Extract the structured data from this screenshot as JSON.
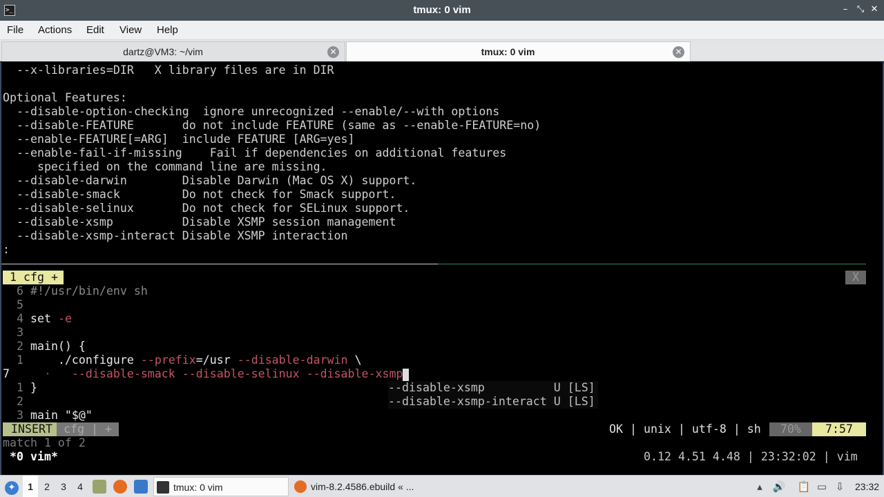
{
  "window": {
    "title": "tmux: 0 vim",
    "minimize_glyph": "–",
    "maximize_glyph": "⤡",
    "close_glyph": "✕"
  },
  "menu": [
    "File",
    "Actions",
    "Edit",
    "View",
    "Help"
  ],
  "tabs": [
    {
      "label": "dartz@VM3: ~/vim",
      "close": "✕"
    },
    {
      "label": "tmux: 0 vim",
      "close": "✕"
    }
  ],
  "help_lines": [
    "  --x-libraries=DIR   X library files are in DIR",
    "",
    "Optional Features:",
    "  --disable-option-checking  ignore unrecognized --enable/--with options",
    "  --disable-FEATURE       do not include FEATURE (same as --enable-FEATURE=no)",
    "  --enable-FEATURE[=ARG]  include FEATURE [ARG=yes]",
    "  --enable-fail-if-missing    Fail if dependencies on additional features",
    "     specified on the command line are missing.",
    "  --disable-darwin        Disable Darwin (Mac OS X) support.",
    "  --disable-smack         Do not check for Smack support.",
    "  --disable-selinux       Do not check for SELinux support.",
    "  --disable-xsmp          Disable XSMP session management",
    "  --disable-xsmp-interact Disable XSMP interaction",
    ":"
  ],
  "vim": {
    "tabline_label": "1 cfg +",
    "tabline_close": "X",
    "lines": {
      "l1_num": "6",
      "l1_text": "#!/usr/bin/env sh",
      "l2_num": "5",
      "l3_num": "4",
      "l3_kw": "set ",
      "l3_opt": "-e",
      "l4_num": "3",
      "l5_num": "2",
      "l5_text": "main() {",
      "l6_num": "1",
      "l6_cmd": "    ./configure ",
      "l6_opt1": "--prefix",
      "l6_eq": "=/usr ",
      "l6_opt2": "--disable-darwin",
      "l6_bs": " \\",
      "l7_num": "7",
      "l7_dot": "     ·",
      "l7_opts": "   --disable-smack --disable-selinux --disable-xsmp",
      "l8_num": "1",
      "l8_text": "}",
      "l9_num": "2",
      "l10_num": "3",
      "l10_text": "main \"$@\""
    },
    "completion": [
      "--disable-xsmp          U [LS]",
      "--disable-xsmp-interact U [LS]"
    ],
    "status": {
      "mode": "INSERT",
      "file": "cfg | +",
      "info": "OK | unix | utf-8 | sh",
      "percent": "70%",
      "position": "7:57"
    },
    "message": "match 1 of 2"
  },
  "tmux": {
    "window": "*0 vim*",
    "status_right": "0.12 4.51 4.48 | 23:32:02 | vim"
  },
  "taskbar": {
    "desktops": [
      "1",
      "2",
      "3",
      "4"
    ],
    "tasks": [
      "tmux: 0 vim",
      "vim-8.2.4586.ebuild « ..."
    ],
    "clock": "23:32"
  }
}
